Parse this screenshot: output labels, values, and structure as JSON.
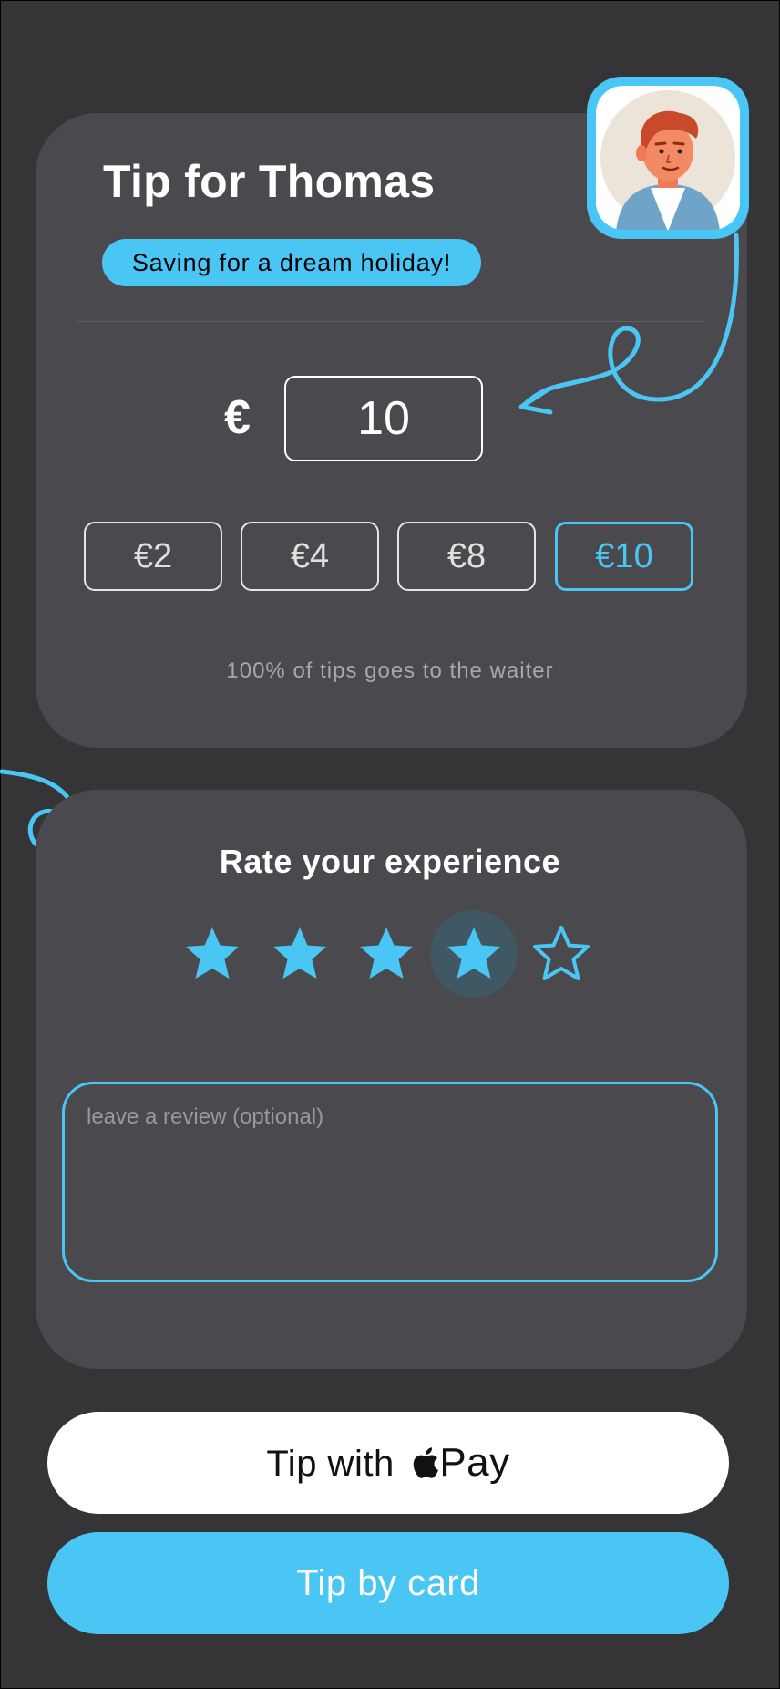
{
  "tip_card": {
    "title": "Tip for Thomas",
    "goal": "Saving for a dream holiday!",
    "currency_symbol": "€",
    "amount": "10",
    "presets": [
      "€2",
      "€4",
      "€8",
      "€10"
    ],
    "selected_preset": "€10",
    "note": "100% of tips goes to the waiter"
  },
  "rating": {
    "title": "Rate your experience",
    "stars_total": 5,
    "stars_selected": 4,
    "review_placeholder": "leave a review (optional)"
  },
  "actions": {
    "apple_pay_prefix": "Tip with",
    "apple_pay_suffix": "Pay",
    "card_label": "Tip by card"
  },
  "colors": {
    "background": "#353437",
    "card": "#4a494d",
    "accent": "#4ac6f5"
  },
  "icons": [
    "avatar-illustration",
    "star-icon",
    "apple-logo-icon",
    "decorative-arrow"
  ]
}
